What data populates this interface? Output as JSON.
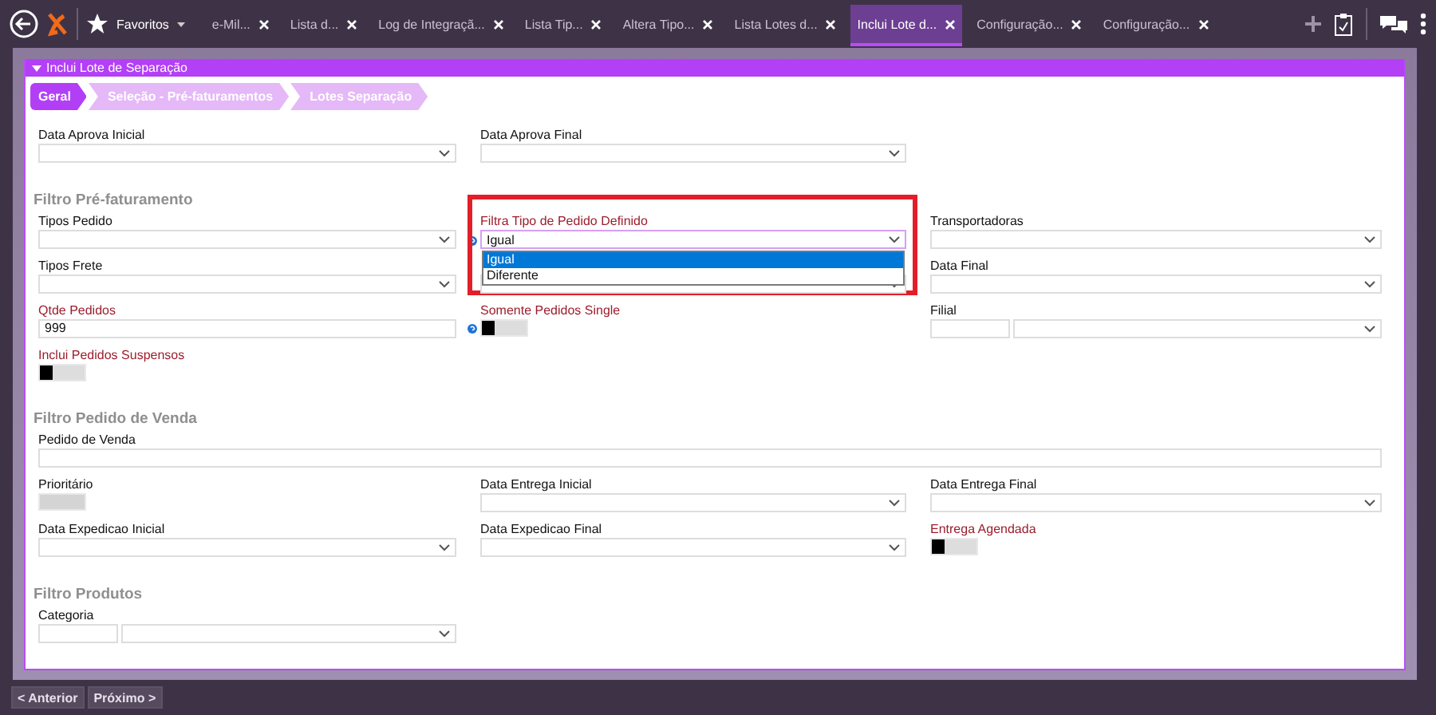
{
  "topbar": {
    "favorites": "Favoritos",
    "tabs": [
      {
        "label": "e-Mil...",
        "selected": false
      },
      {
        "label": "Lista d...",
        "selected": false
      },
      {
        "label": "Log de Integraçã...",
        "selected": false
      },
      {
        "label": "Lista Tip...",
        "selected": false
      },
      {
        "label": "Altera Tipo...",
        "selected": false
      },
      {
        "label": "Lista Lotes d...",
        "selected": false
      },
      {
        "label": "Inclui Lote d...",
        "selected": true
      },
      {
        "label": "Configuração...",
        "selected": false
      },
      {
        "label": "Configuração...",
        "selected": false
      }
    ]
  },
  "panel": {
    "title": "Inclui Lote de Separação",
    "steps": [
      {
        "label": "Geral",
        "selected": true
      },
      {
        "label": "Seleção - Pré-faturamentos",
        "selected": false
      },
      {
        "label": "Lotes Separação",
        "selected": false
      }
    ],
    "sections": [
      {
        "fields": [
          {
            "kind": "select",
            "label": "Data Aprova Inicial",
            "required": false
          },
          {
            "kind": "select",
            "label": "Data Aprova Final",
            "required": false
          }
        ]
      },
      {
        "title": "Filtro Pré-faturamento",
        "fields": [
          {
            "kind": "select",
            "label": "Tipos Pedido",
            "required": false
          },
          {
            "kind": "select",
            "label": "Filtra Tipo de Pedido Definido",
            "required": true,
            "help": true,
            "highlighted": true,
            "value": "Igual",
            "options": [
              {
                "label": "Igual",
                "selected": true
              },
              {
                "label": "Diferente",
                "selected": false
              }
            ]
          },
          {
            "kind": "select",
            "label": "Transportadoras",
            "required": false
          },
          {
            "kind": "select",
            "label": "Tipos Frete",
            "required": false
          },
          {
            "kind": "select"
          },
          {
            "kind": "select",
            "label": "Data Final",
            "required": false
          },
          {
            "kind": "text",
            "label": "Qtde Pedidos",
            "required": true,
            "value": "999"
          },
          {
            "kind": "toggle",
            "label": "Somente Pedidos Single",
            "required": true,
            "help": true,
            "on": false
          },
          {
            "kind": "split",
            "label": "Filial",
            "required": false
          },
          {
            "kind": "toggle",
            "label": "Inclui Pedidos Suspensos",
            "required": true,
            "on": false
          }
        ]
      },
      {
        "title": "Filtro Pedido de Venda",
        "fields": [
          {
            "kind": "wide-text",
            "label": "Pedido de Venda",
            "required": false
          },
          {
            "kind": "toggle",
            "label": "Prioritário",
            "required": false,
            "disabled": true
          },
          {
            "kind": "select",
            "label": "Data Entrega Inicial",
            "required": false
          },
          {
            "kind": "select",
            "label": "Data Entrega Final",
            "required": false
          },
          {
            "kind": "select",
            "label": "Data Expedicao Inicial",
            "required": false
          },
          {
            "kind": "select",
            "label": "Data Expedicao Final",
            "required": false
          },
          {
            "kind": "toggle",
            "label": "Entrega Agendada",
            "required": true,
            "on": false
          }
        ]
      },
      {
        "title": "Filtro Produtos",
        "fields": [
          {
            "kind": "split",
            "label": "Categoria",
            "required": false
          }
        ]
      }
    ]
  },
  "footer": {
    "buttons": [
      "< Anterior",
      "Próximo >"
    ]
  }
}
